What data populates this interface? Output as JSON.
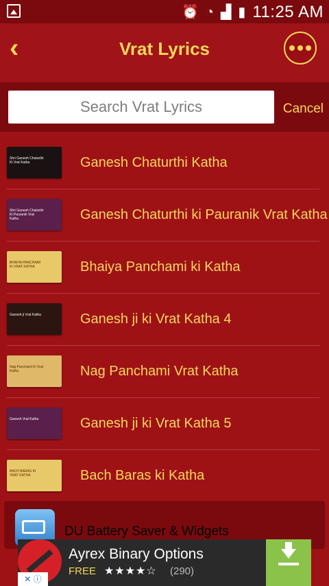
{
  "status_bar": {
    "time": "11:25 AM",
    "icons": [
      "image-icon",
      "alarm-icon",
      "wifi-icon",
      "signal-icon",
      "battery-icon"
    ]
  },
  "app_bar": {
    "title": "Vrat Lyrics",
    "back_icon": "back-chevron-icon",
    "more_icon": "more-dots-icon"
  },
  "search": {
    "placeholder": "Search Vrat Lyrics",
    "value": "",
    "cancel_label": "Cancel"
  },
  "items": [
    {
      "label": "Ganesh Chaturthi Katha",
      "thumb_text": "Shri Ganesh Chaturthi Ki Vrat Katha",
      "thumb_bg": "#1a1212",
      "thumb_style": "dark"
    },
    {
      "label": "Ganesh Chaturthi ki Pauranik Vrat Katha",
      "thumb_text": "Shri Ganesh Chaturthi Ki Pauranik Vrat Katha",
      "thumb_bg": "#5a1f4a",
      "thumb_style": "dark"
    },
    {
      "label": "Bhaiya Panchami ki Katha",
      "thumb_text": "BHAIYA PANCHAMI KI VRAT KATHA",
      "thumb_bg": "#e8c96a",
      "thumb_style": "light"
    },
    {
      "label": "Ganesh ji ki Vrat Katha 4",
      "thumb_text": "Ganesh ji Vrat Katha",
      "thumb_bg": "#2a1510",
      "thumb_style": "dark"
    },
    {
      "label": "Nag Panchami Vrat Katha",
      "thumb_text": "Nag Panchami Ki Vrat Katha",
      "thumb_bg": "#e0b86a",
      "thumb_style": "light"
    },
    {
      "label": "Ganesh ji ki Vrat Katha 5",
      "thumb_text": "Ganesh Vrat Katha",
      "thumb_bg": "#5a1f4a",
      "thumb_style": "dark"
    },
    {
      "label": "Bach Baras ki Katha",
      "thumb_text": "BACH BARAS KI VRAT KATHA",
      "thumb_bg": "#e8c96a",
      "thumb_style": "light"
    }
  ],
  "ad_card": {
    "text": "DU Battery Saver & Widgets",
    "icon": "battery-app-icon"
  },
  "banner_ad": {
    "title": "Ayrex Binary Options",
    "price": "FREE",
    "stars": "★★★★☆",
    "rating_count": "(290)",
    "download_icon": "download-icon"
  },
  "colors": {
    "background": "#9e1216",
    "accent": "#f7d75a",
    "searchbar": "#7b0a0e"
  }
}
